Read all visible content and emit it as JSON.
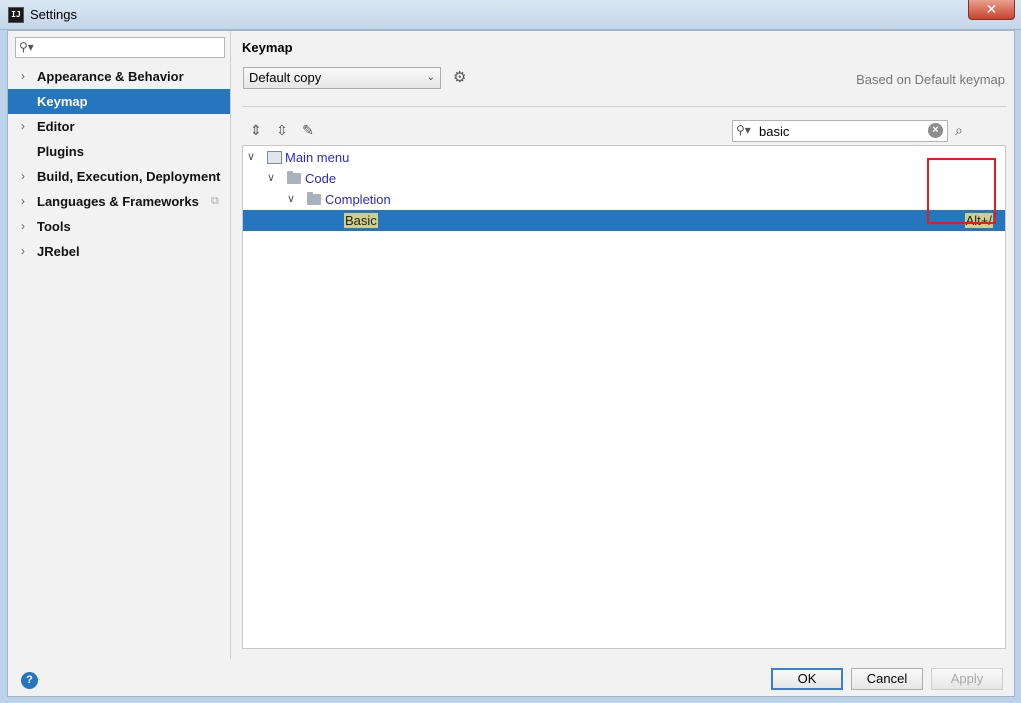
{
  "window": {
    "title": "Settings",
    "app_icon": "IJ",
    "close_label": "✕"
  },
  "sidebar": {
    "search_placeholder": "",
    "items": [
      {
        "label": "Appearance & Behavior",
        "expandable": true
      },
      {
        "label": "Keymap",
        "expandable": false,
        "selected": true
      },
      {
        "label": "Editor",
        "expandable": true
      },
      {
        "label": "Plugins",
        "expandable": false
      },
      {
        "label": "Build, Execution, Deployment",
        "expandable": true
      },
      {
        "label": "Languages & Frameworks",
        "expandable": true
      },
      {
        "label": "Tools",
        "expandable": true
      },
      {
        "label": "JRebel",
        "expandable": true
      }
    ]
  },
  "main": {
    "title": "Keymap",
    "keymap_selected": "Default copy",
    "based_on": "Based on Default keymap",
    "filter_value": "basic",
    "tree": {
      "root": "Main menu",
      "code": "Code",
      "completion": "Completion",
      "action": "Basic",
      "shortcut": "Alt+/"
    }
  },
  "footer": {
    "help": "?",
    "ok": "OK",
    "cancel": "Cancel",
    "apply": "Apply"
  },
  "colors": {
    "selection": "#2675bf",
    "highlight": "#cfcf8a",
    "annotation": "#e01e1e"
  }
}
